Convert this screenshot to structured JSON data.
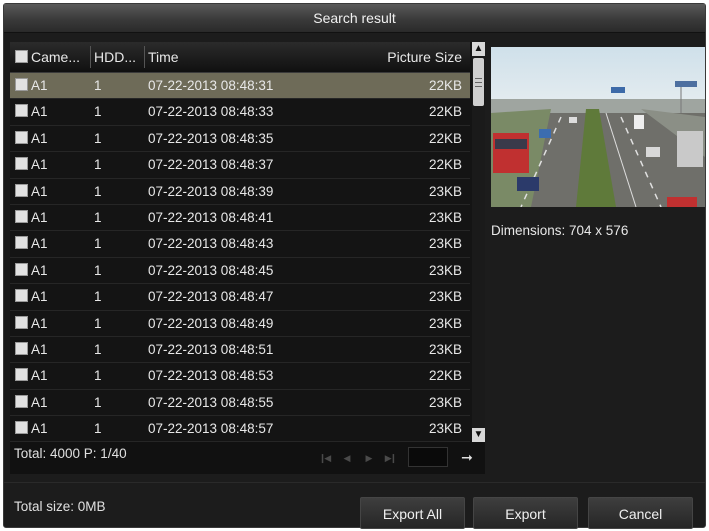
{
  "dialog": {
    "title": "Search result"
  },
  "table": {
    "headers": {
      "camera": "Came...",
      "hdd": "HDD...",
      "time": "Time",
      "picture_size": "Picture Size"
    },
    "rows": [
      {
        "camera": "A1",
        "hdd": "1",
        "time": "07-22-2013 08:48:31",
        "size": "22KB",
        "selected": true
      },
      {
        "camera": "A1",
        "hdd": "1",
        "time": "07-22-2013 08:48:33",
        "size": "22KB"
      },
      {
        "camera": "A1",
        "hdd": "1",
        "time": "07-22-2013 08:48:35",
        "size": "22KB"
      },
      {
        "camera": "A1",
        "hdd": "1",
        "time": "07-22-2013 08:48:37",
        "size": "22KB"
      },
      {
        "camera": "A1",
        "hdd": "1",
        "time": "07-22-2013 08:48:39",
        "size": "23KB"
      },
      {
        "camera": "A1",
        "hdd": "1",
        "time": "07-22-2013 08:48:41",
        "size": "23KB"
      },
      {
        "camera": "A1",
        "hdd": "1",
        "time": "07-22-2013 08:48:43",
        "size": "23KB"
      },
      {
        "camera": "A1",
        "hdd": "1",
        "time": "07-22-2013 08:48:45",
        "size": "23KB"
      },
      {
        "camera": "A1",
        "hdd": "1",
        "time": "07-22-2013 08:48:47",
        "size": "23KB"
      },
      {
        "camera": "A1",
        "hdd": "1",
        "time": "07-22-2013 08:48:49",
        "size": "23KB"
      },
      {
        "camera": "A1",
        "hdd": "1",
        "time": "07-22-2013 08:48:51",
        "size": "23KB"
      },
      {
        "camera": "A1",
        "hdd": "1",
        "time": "07-22-2013 08:48:53",
        "size": "22KB"
      },
      {
        "camera": "A1",
        "hdd": "1",
        "time": "07-22-2013 08:48:55",
        "size": "23KB"
      },
      {
        "camera": "A1",
        "hdd": "1",
        "time": "07-22-2013 08:48:57",
        "size": "23KB"
      }
    ]
  },
  "pager": {
    "total": "Total: 4000  P: 1/40",
    "page_input": ""
  },
  "preview": {
    "dimensions": "Dimensions: 704 x 576"
  },
  "footer": {
    "total_size": "Total size: 0MB",
    "export_all": "Export All",
    "export": "Export",
    "cancel": "Cancel"
  },
  "icons": {
    "scroll_up": "chevron-up-icon",
    "scroll_down": "chevron-down-icon",
    "first_page": "first-page-icon",
    "prev_page": "prev-page-icon",
    "next_page": "next-page-icon",
    "last_page": "last-page-icon",
    "go": "arrow-right-icon"
  },
  "colors": {
    "background": "#1c1c1c",
    "selected_row": "#6e6b58"
  }
}
